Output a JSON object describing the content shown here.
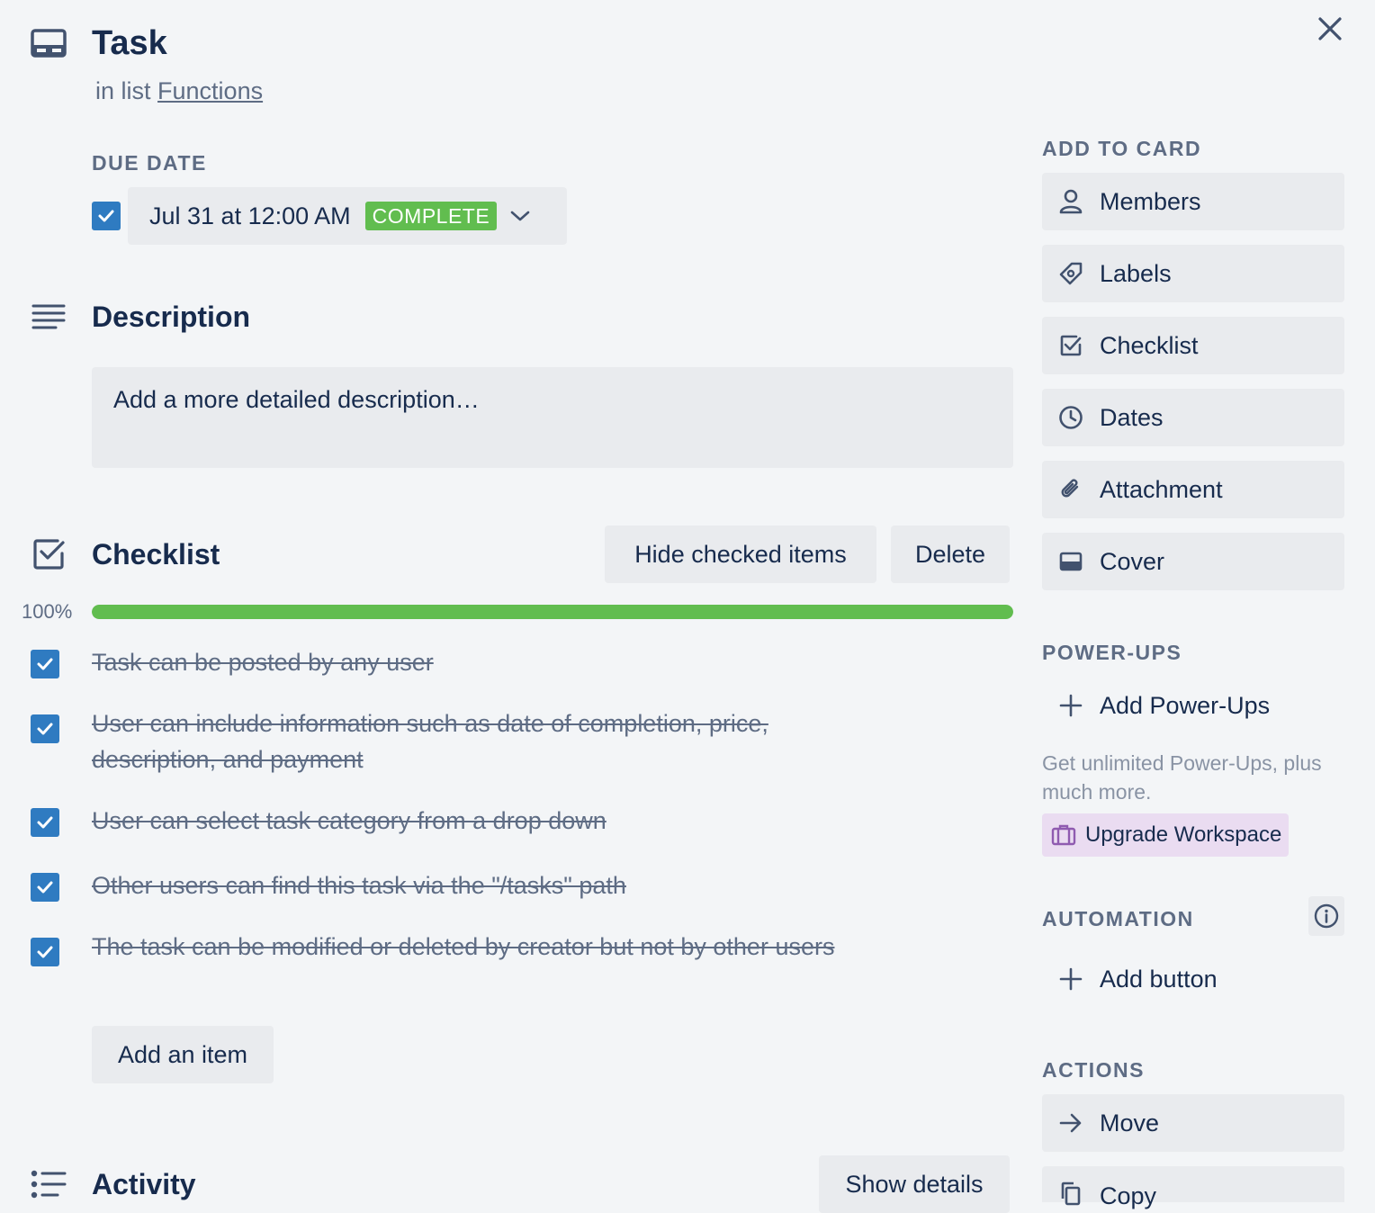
{
  "card": {
    "title": "Task",
    "in_list_prefix": "in list",
    "list_name": "Functions"
  },
  "due_date": {
    "label": "DUE DATE",
    "checked": true,
    "value": "Jul 31 at 12:00 AM",
    "status": "COMPLETE"
  },
  "description": {
    "heading": "Description",
    "placeholder": "Add a more detailed description…"
  },
  "checklist": {
    "heading": "Checklist",
    "hide_checked_label": "Hide checked items",
    "delete_label": "Delete",
    "progress_text": "100%",
    "progress_fraction": 1.0,
    "items": [
      {
        "text": "Task can be posted by any user",
        "checked": true
      },
      {
        "text": "User can include information such as date of completion, price, description, and payment",
        "checked": true
      },
      {
        "text": "User can select task category from a drop down",
        "checked": true
      },
      {
        "text": "Other users can find this task via the \"/tasks\" path",
        "checked": true
      },
      {
        "text": "The task can be modified or deleted by creator but not by other users",
        "checked": true
      }
    ],
    "add_item_label": "Add an item"
  },
  "activity": {
    "heading": "Activity",
    "show_details_label": "Show details"
  },
  "sidebar": {
    "add_to_card": {
      "label": "ADD TO CARD",
      "items": [
        {
          "label": "Members",
          "icon": "person-icon"
        },
        {
          "label": "Labels",
          "icon": "tag-icon"
        },
        {
          "label": "Checklist",
          "icon": "checkbox-icon"
        },
        {
          "label": "Dates",
          "icon": "clock-icon"
        },
        {
          "label": "Attachment",
          "icon": "paperclip-icon"
        },
        {
          "label": "Cover",
          "icon": "card-cover-icon"
        }
      ]
    },
    "power_ups": {
      "label": "POWER-UPS",
      "add_label": "Add Power-Ups",
      "promo_text": "Get unlimited Power-Ups, plus much more.",
      "upgrade_label": "Upgrade Workspace"
    },
    "automation": {
      "label": "AUTOMATION",
      "add_button_label": "Add button"
    },
    "actions": {
      "label": "ACTIONS",
      "items": [
        {
          "label": "Move",
          "icon": "arrow-right-icon"
        },
        {
          "label": "Copy",
          "icon": "copy-icon"
        }
      ]
    }
  },
  "colors": {
    "accent_blue": "#2f7bc1",
    "complete_green": "#61bd4f",
    "upgrade_purple": "#eadcf1"
  }
}
